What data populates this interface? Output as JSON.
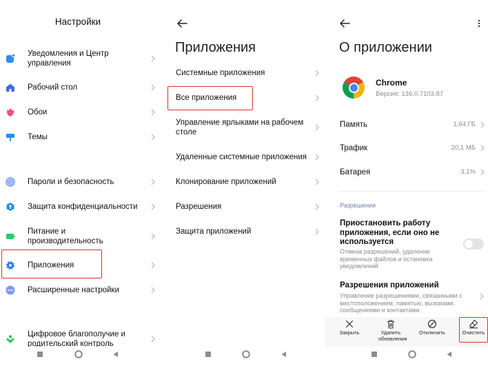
{
  "colors": {
    "accent": "#2a7df0",
    "highlight": "#d9312f",
    "text": "#111111",
    "secondary": "#8a8a8a"
  },
  "settings": {
    "title": "Настройки",
    "items": [
      {
        "label": "Уведомления и Центр управления",
        "icon": "notifications-icon"
      },
      {
        "label": "Рабочий стол",
        "icon": "home-screen-icon"
      },
      {
        "label": "Обои",
        "icon": "wallpaper-icon"
      },
      {
        "label": "Темы",
        "icon": "themes-icon"
      },
      {
        "label": "Пароли и безопасность",
        "icon": "fingerprint-icon"
      },
      {
        "label": "Защита конфиденциальности",
        "icon": "privacy-icon"
      },
      {
        "label": "Питание и производительность",
        "icon": "battery-icon"
      },
      {
        "label": "Приложения",
        "icon": "gear-icon",
        "highlighted": true
      },
      {
        "label": "Расширенные настройки",
        "icon": "more-icon"
      },
      {
        "label": "Цифровое благополучие и родительский контроль",
        "icon": "wellbeing-icon"
      }
    ]
  },
  "apps": {
    "title": "Приложения",
    "items": [
      {
        "label": "Системные приложения"
      },
      {
        "label": "Все приложения",
        "highlighted": true
      },
      {
        "label": "Управление ярлыками на рабочем столе"
      },
      {
        "label": "Удаленные системные приложения"
      },
      {
        "label": "Клонирование приложений"
      },
      {
        "label": "Разрешения"
      },
      {
        "label": "Защита приложений"
      }
    ]
  },
  "app_info": {
    "title": "О приложении",
    "app_name": "Chrome",
    "version": "Версия: 136.0.7103.87",
    "stats": [
      {
        "label": "Память",
        "value": "1,64 ГБ"
      },
      {
        "label": "Трафик",
        "value": "20,1 МБ"
      },
      {
        "label": "Батарея",
        "value": "3,1%"
      }
    ],
    "permissions_header": "Разрешения",
    "pause": {
      "title": "Приостановить работу приложения, если оно не используется",
      "description": "Отмена разрешений, удаление временных файлов и остановка уведомлений",
      "enabled": false
    },
    "app_permissions": {
      "title": "Разрешения приложений",
      "description": "Управление разрешениями, связанными с местоположением, памятью, вызовами, сообщениями и контактами."
    },
    "actions": [
      {
        "label": "Закрыть",
        "icon": "close-icon"
      },
      {
        "label": "Удалить обновления",
        "icon": "trash-icon"
      },
      {
        "label": "Отключить",
        "icon": "disable-icon"
      },
      {
        "label": "Очистить",
        "icon": "eraser-icon",
        "highlighted": true
      }
    ]
  },
  "nav": {
    "buttons": [
      "recents-icon",
      "home-icon",
      "back-icon"
    ]
  }
}
